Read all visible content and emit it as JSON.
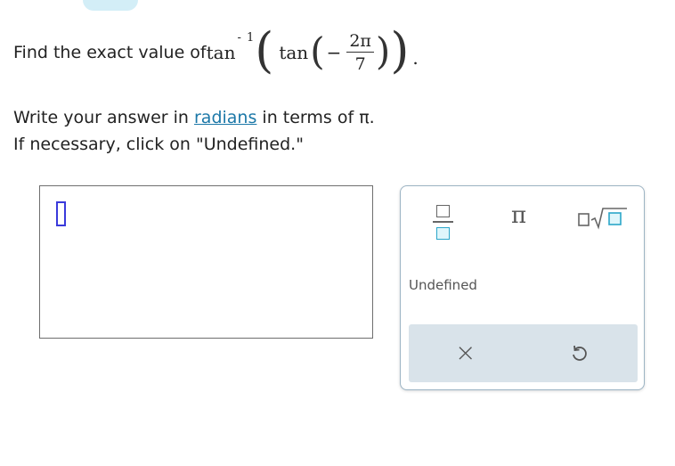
{
  "question": {
    "prefix": "Find the exact value of ",
    "outer_fn": "tan",
    "outer_exp": "- 1",
    "inner_fn": "tan",
    "minus": "−",
    "numerator": "2π",
    "denominator": "7",
    "period": "."
  },
  "instructions": {
    "line1_before": "Write your answer in ",
    "line1_link": "radians",
    "line1_after": " in terms of π.",
    "line2": "If necessary, click on \"Undefined.\""
  },
  "keypad": {
    "pi_label": "π",
    "undefined_label": "Undefined",
    "clear_label": "×",
    "icons": [
      "fraction-icon",
      "pi-icon",
      "sqrt-icon",
      "clear-icon",
      "undo-icon"
    ]
  },
  "colors": {
    "accent": "#2ba6c9",
    "link": "#1c78a8",
    "cursor": "#3a3adb",
    "keypad_bar": "#d9e3ea"
  }
}
